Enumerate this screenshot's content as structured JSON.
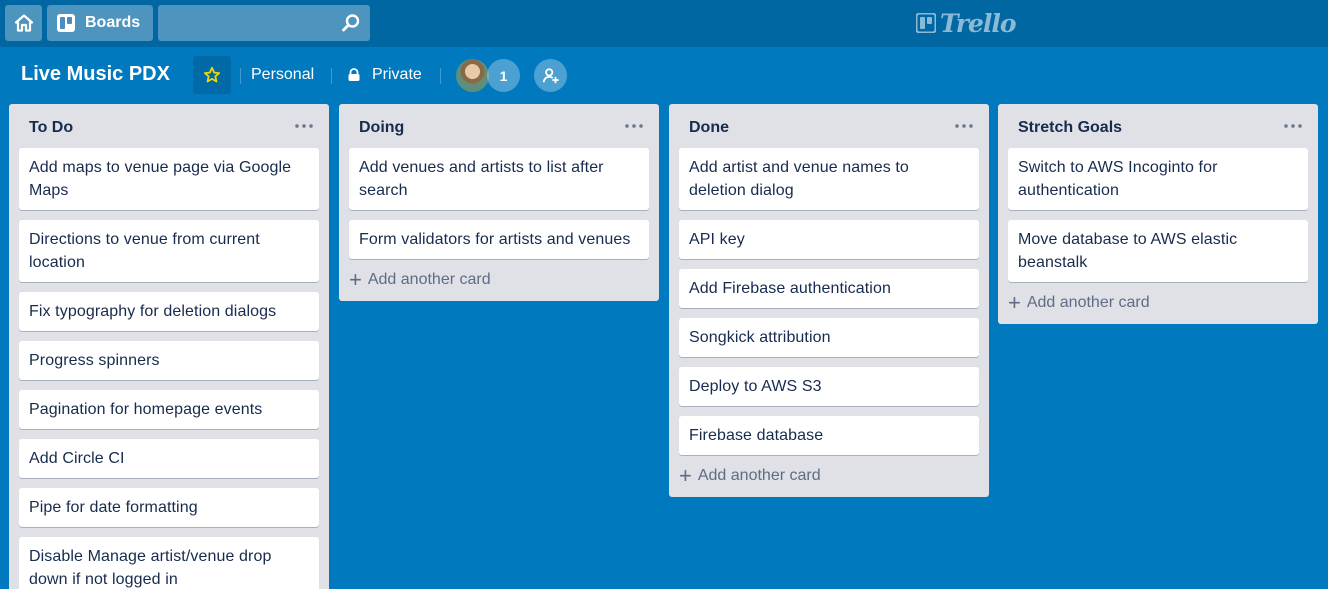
{
  "topbar": {
    "boards_label": "Boards",
    "search_value": "",
    "search_placeholder": "",
    "logo_text": "Trello"
  },
  "board": {
    "title": "Live Music PDX",
    "team": "Personal",
    "visibility": "Private",
    "member_count": "1"
  },
  "colors": {
    "board_bg": "#0079bf",
    "header_bg": "#0067a3",
    "list_bg": "#dfe1e6",
    "star": "#f2d600"
  },
  "lists": [
    {
      "title": "To Do",
      "cards": [
        "Add maps to venue page via Google Maps",
        "Directions to venue from current location",
        "Fix typography for deletion dialogs",
        "Progress spinners",
        "Pagination for homepage events",
        "Add Circle CI",
        "Pipe for date formatting",
        "Disable Manage artist/venue drop down if not logged in"
      ],
      "add_label": ""
    },
    {
      "title": "Doing",
      "cards": [
        "Add venues and artists to list after search",
        "Form validators for artists and venues"
      ],
      "add_label": "Add another card"
    },
    {
      "title": "Done",
      "cards": [
        "Add artist and venue names to deletion dialog",
        "API key",
        "Add Firebase authentication",
        "Songkick attribution",
        "Deploy to AWS S3",
        "Firebase database"
      ],
      "add_label": "Add another card"
    },
    {
      "title": "Stretch Goals",
      "cards": [
        "Switch to AWS Incoginto for authentication",
        "Move database to AWS elastic beanstalk"
      ],
      "add_label": "Add another card"
    }
  ]
}
